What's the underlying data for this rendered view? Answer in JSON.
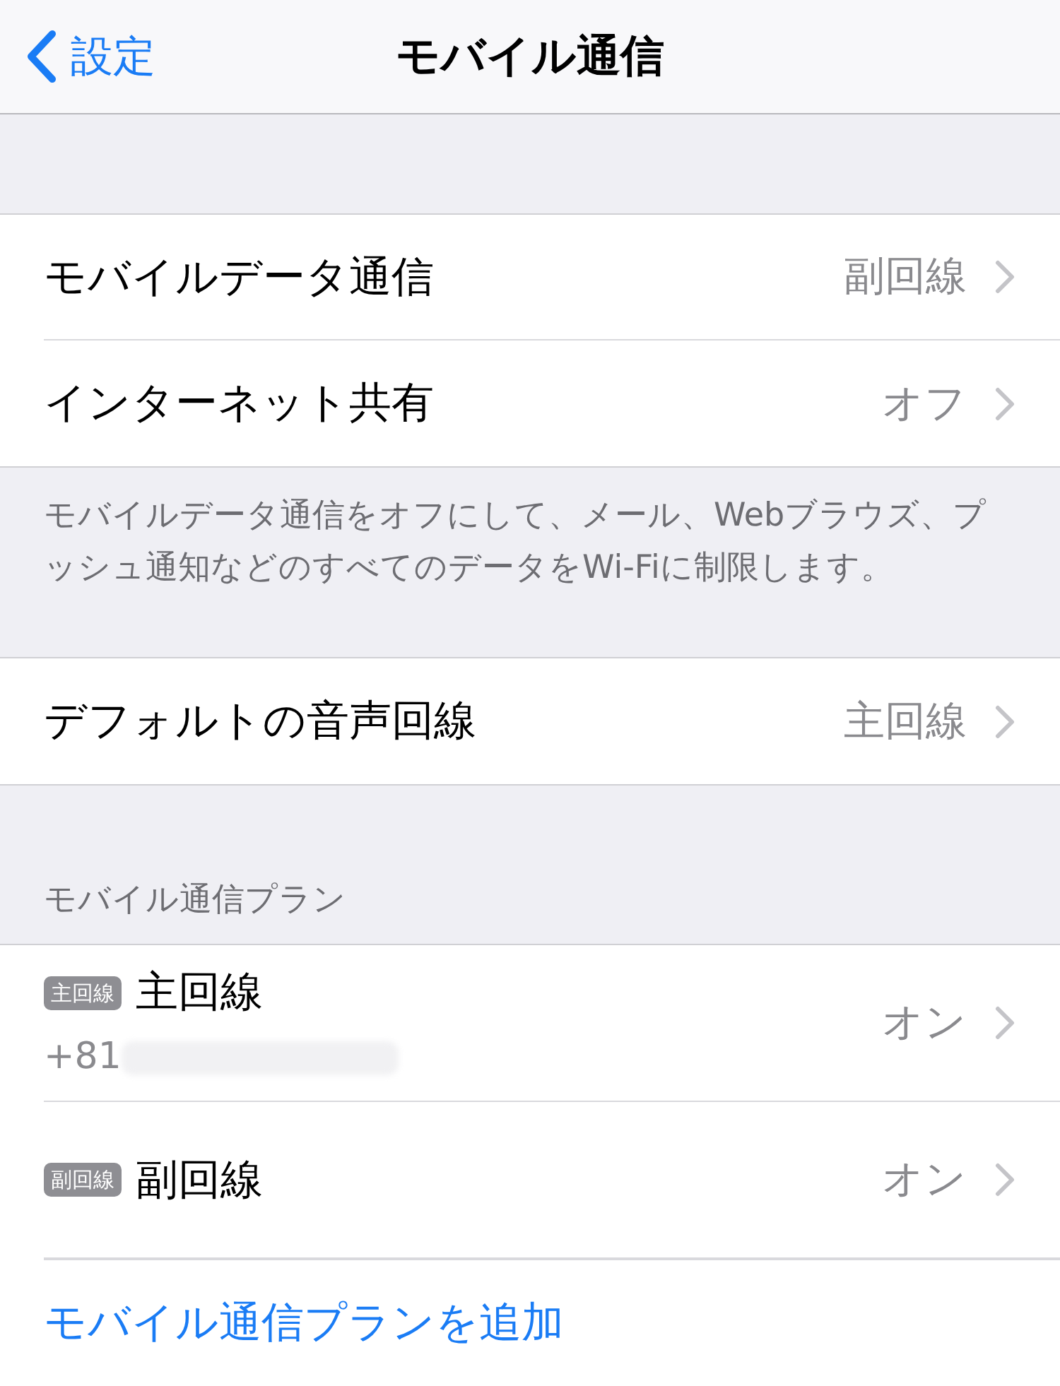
{
  "nav": {
    "back": "設定",
    "title": "モバイル通信"
  },
  "group1": [
    {
      "label": "モバイルデータ通信",
      "value": "副回線"
    },
    {
      "label": "インターネット共有",
      "value": "オフ"
    }
  ],
  "group1_footer": "モバイルデータ通信をオフにして、メール、Webブラウズ、プッシュ通知などのすべてのデータをWi-Fiに制限します。",
  "group2": [
    {
      "label": "デフォルトの音声回線",
      "value": "主回線"
    }
  ],
  "plans_header": "モバイル通信プラン",
  "plans": [
    {
      "badge": "主回線",
      "label": "主回線",
      "number": "+81",
      "value": "オン"
    },
    {
      "badge": "副回線",
      "label": "副回線",
      "value": "オン"
    }
  ],
  "add_plan": "モバイル通信プランを追加"
}
